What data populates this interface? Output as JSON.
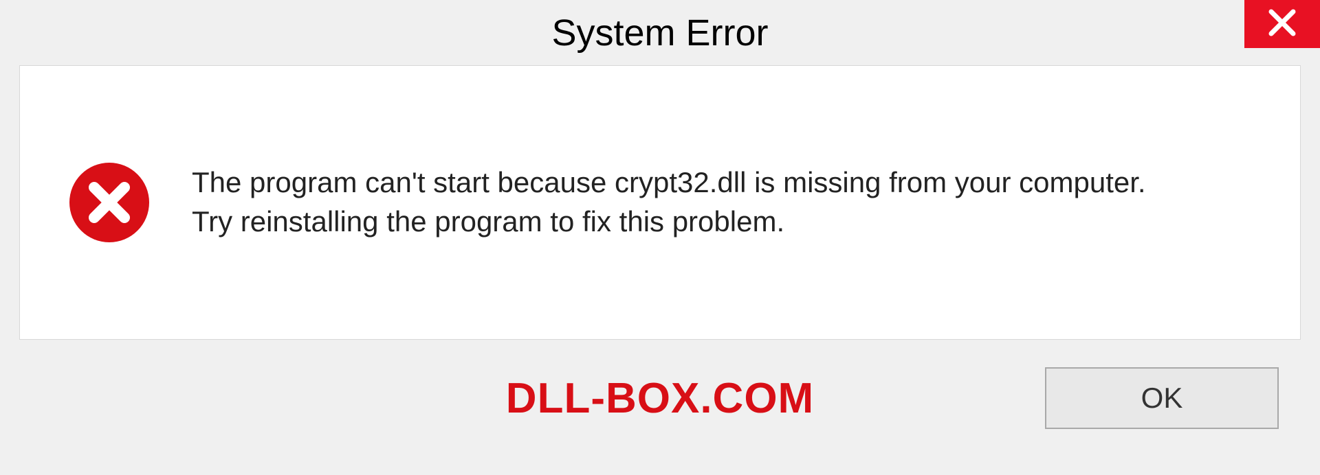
{
  "dialog": {
    "title": "System Error",
    "message_line1": "The program can't start because crypt32.dll is missing from your computer.",
    "message_line2": "Try reinstalling the program to fix this problem.",
    "ok_label": "OK"
  },
  "watermark": "DLL-BOX.COM",
  "colors": {
    "close_bg": "#e81123",
    "error_icon": "#d80f16",
    "watermark": "#d80f16"
  }
}
